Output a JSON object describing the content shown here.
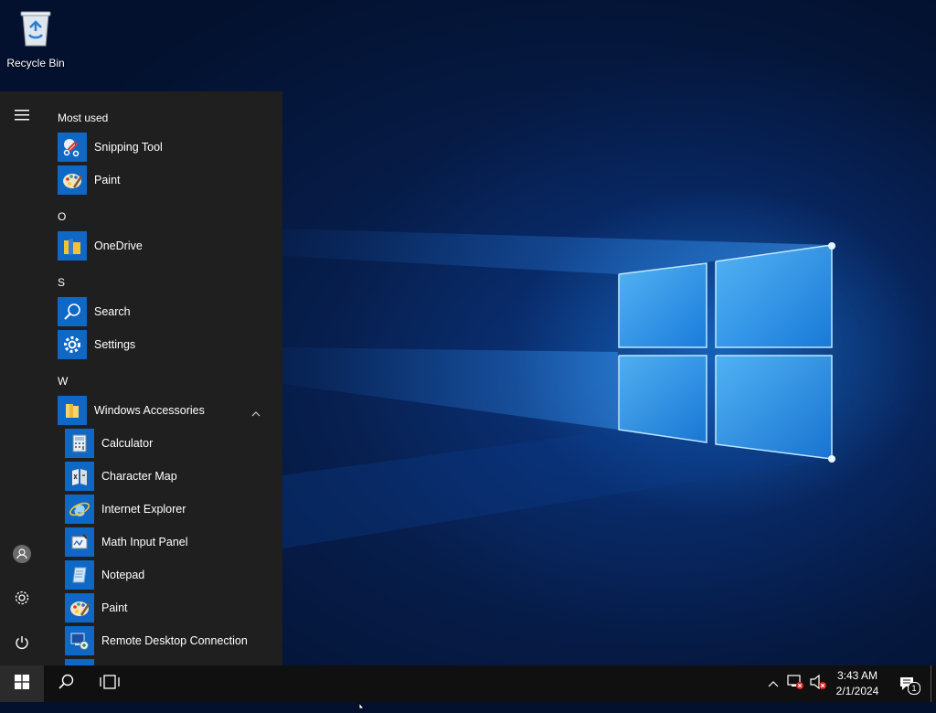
{
  "desktop": {
    "icons": [
      {
        "label": "Recycle Bin",
        "icon": "recycle-bin-icon"
      }
    ]
  },
  "start_menu": {
    "most_used_header": "Most used",
    "most_used": [
      {
        "label": "Snipping Tool",
        "icon": "snipping-tool-icon"
      },
      {
        "label": "Paint",
        "icon": "paint-icon"
      }
    ],
    "groups": [
      {
        "letter": "O",
        "items": [
          {
            "label": "OneDrive",
            "icon": "onedrive-icon"
          }
        ]
      },
      {
        "letter": "S",
        "items": [
          {
            "label": "Search",
            "icon": "search-icon"
          },
          {
            "label": "Settings",
            "icon": "settings-icon"
          }
        ]
      },
      {
        "letter": "W",
        "folder": {
          "label": "Windows Accessories",
          "icon": "folder-icon",
          "expanded": true
        },
        "items": [
          {
            "label": "Calculator",
            "icon": "calculator-icon"
          },
          {
            "label": "Character Map",
            "icon": "character-map-icon"
          },
          {
            "label": "Internet Explorer",
            "icon": "internet-explorer-icon"
          },
          {
            "label": "Math Input Panel",
            "icon": "math-input-panel-icon"
          },
          {
            "label": "Notepad",
            "icon": "notepad-icon"
          },
          {
            "label": "Paint",
            "icon": "paint-icon"
          },
          {
            "label": "Remote Desktop Connection",
            "icon": "remote-desktop-icon"
          }
        ]
      }
    ],
    "rail": [
      "hamburger-icon",
      "user-icon",
      "settings-gear-icon",
      "power-icon"
    ]
  },
  "taskbar": {
    "buttons": [
      "windows-start-icon",
      "search-icon",
      "task-view-icon"
    ],
    "tray": [
      "show-hidden-icons-chevron",
      "network-disconnected-icon",
      "volume-muted-icon"
    ],
    "clock": {
      "time": "3:43 AM",
      "date": "2/1/2024"
    },
    "notifications": {
      "count": "1"
    }
  },
  "colors": {
    "accent": "#0f68c6",
    "menu_bg": "#1f1f1f",
    "taskbar_bg": "#101010"
  }
}
